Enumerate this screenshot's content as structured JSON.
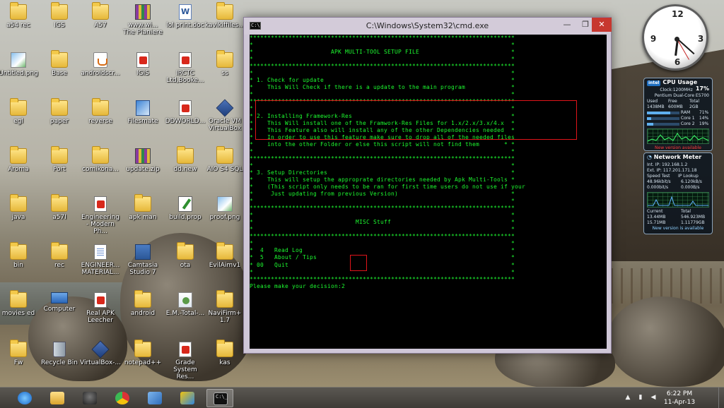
{
  "desktop": {
    "icons": [
      {
        "label": "a54 rec",
        "type": "folder"
      },
      {
        "label": "IGS",
        "type": "folder"
      },
      {
        "label": "A57",
        "type": "folder"
      },
      {
        "label": "www.wi...\nThe Planiere",
        "type": "zip"
      },
      {
        "label": "lol print.doc",
        "type": "word"
      },
      {
        "label": "kavikiffiles...",
        "type": "folder"
      },
      {
        "label": "Untitled.png",
        "type": "img"
      },
      {
        "label": "Base",
        "type": "folder"
      },
      {
        "label": "androidscr...",
        "type": "java"
      },
      {
        "label": "IGIS",
        "type": "pdf"
      },
      {
        "label": "IRCTC Ltd,Booke...",
        "type": "pdf"
      },
      {
        "label": "ss",
        "type": "folder"
      },
      {
        "label": "egl",
        "type": "folder"
      },
      {
        "label": "paper",
        "type": "folder"
      },
      {
        "label": "reverse",
        "type": "folder"
      },
      {
        "label": "Filesmate",
        "type": "tool"
      },
      {
        "label": "DDWORLD...",
        "type": "pdf"
      },
      {
        "label": "Oracle VM VirtualBox",
        "type": "vbox"
      },
      {
        "label": "Aroma",
        "type": "folder"
      },
      {
        "label": "Port",
        "type": "folder"
      },
      {
        "label": "comikona...",
        "type": "folder"
      },
      {
        "label": "update.zip",
        "type": "zip"
      },
      {
        "label": "dd.new",
        "type": "folder"
      },
      {
        "label": "AIO S4 SQL",
        "type": "folder"
      },
      {
        "label": "java",
        "type": "folder"
      },
      {
        "label": "a57I",
        "type": "folder"
      },
      {
        "label": "Engineering - Modern Ph...",
        "type": "pdf"
      },
      {
        "label": "apk man",
        "type": "folder"
      },
      {
        "label": "build.prop",
        "type": "pencil"
      },
      {
        "label": "proof.png",
        "type": "img"
      },
      {
        "label": "bin",
        "type": "folder"
      },
      {
        "label": "rec",
        "type": "folder"
      },
      {
        "label": "ENGINEER... MATERIAL...",
        "type": "doc"
      },
      {
        "label": "Camtasia Studio 7",
        "type": "film"
      },
      {
        "label": "ota",
        "type": "folder"
      },
      {
        "label": "EvilAimv1",
        "type": "folder"
      },
      {
        "label": "movies ed",
        "type": "folder"
      },
      {
        "label": "Computer",
        "type": "comp"
      },
      {
        "label": "Real APK Leecher",
        "type": "pdf"
      },
      {
        "label": "android",
        "type": "folder"
      },
      {
        "label": "E.M.-Total-...",
        "type": "tux"
      },
      {
        "label": "NaviFirm+ 1.7",
        "type": "folder"
      },
      {
        "label": "Fw",
        "type": "folder"
      },
      {
        "label": "Recycle Bin",
        "type": "bin"
      },
      {
        "label": "VirtualBox-...",
        "type": "vbox"
      },
      {
        "label": "notepad++",
        "type": "folder"
      },
      {
        "label": "Grade System Res...",
        "type": "pdf"
      },
      {
        "label": "kas",
        "type": "folder"
      }
    ]
  },
  "window": {
    "icon_text": "C:\\",
    "title": "C:\\Windows\\System32\\cmd.exe",
    "min_glyph": "—",
    "max_glyph": "❐",
    "close_glyph": "✕"
  },
  "console": {
    "lines": [
      "***************************************************************************",
      "*                                                                         *",
      "*                      APK MULTI-TOOL SETUP FILE                          *",
      "*                                                                         *",
      "***************************************************************************",
      "*                                                                         *",
      "* 1. Check for update                                                     *",
      "*    This Will Check if there is a update to the main program             *",
      "*                                                                         *",
      "***************************************************************************",
      "*                                                                         *",
      "* 2. Installing Framework-Res                                             *",
      "*    This Will install one of the Framwork-Res Files for 1.x/2.x/3.x/4.x  *",
      "*    This Feature also will install any of the other Dependencies needed  *",
      "*    In order to use this feature make sure to drop all of the needed files",
      "*    into the other Folder or else this script will not find them       * *",
      "*                                                                         *",
      "***************************************************************************",
      "*                                                                         *",
      "* 3. Setup Directories                                                    *",
      "*    This will setup the approprate directories needed by Apk Multi-Tools *",
      "*    (This script only needs to be ran for first time users do not use if your",
      "*     Just updating from previous Version)                                *",
      "*                                                                         *",
      "***************************************************************************",
      "*                                                                         *",
      "*                             MISC Stuff                                  *",
      "*                                                                         *",
      "***************************************************************************",
      "*                                                                         *",
      "*  4   Read Log                                                           *",
      "*  5   About / Tips                                                       *",
      "* 00   Quit                                                               *",
      "*                                                                         *",
      "***************************************************************************",
      "Please make your decision:2"
    ]
  },
  "gadgets": {
    "cpu": {
      "brand": "intel",
      "title": "CPU Usage",
      "usage": "17%",
      "clock": "Clock:1200MHz",
      "model": "Pentium Dual-Core E5700",
      "mem_headers": [
        "Used",
        "Free",
        "Total"
      ],
      "mem_values": [
        "1438MB",
        "600MB",
        "2GB"
      ],
      "ram_label": "RAM",
      "ram_pct": "71%",
      "ram_fill": 0.71,
      "core1_label": "Core 1",
      "core1_pct": "14%",
      "core1_fill": 0.14,
      "core2_label": "Core 2",
      "core2_pct": "19%",
      "core2_fill": 0.19,
      "notice": "New version available"
    },
    "network": {
      "title": "Network Meter",
      "int_ip": "Int. IP: 192.168.1.2",
      "ext_ip": "Ext. IP: 117.201.171.18",
      "speed_label": "Speed Test",
      "lookup_label": "IP Lookup",
      "up_rate": "48.96kbit/s",
      "up_bytes": "6.120kB/s",
      "down_rate": "0.000bit/s",
      "down_bytes": "0.000B/s",
      "current_label": "Current",
      "total_label": "Total",
      "cur_up": "13.44MB",
      "tot_up": "546.923MB",
      "cur_down": "15.71MB",
      "tot_down": "1.11779GB",
      "notice": "New version is available"
    }
  },
  "clock_gadget": {
    "numerals": [
      "12",
      "3",
      "6",
      "9"
    ]
  },
  "taskbar": {
    "items": [
      {
        "name": "internet-explorer",
        "icon": "ie-icon",
        "active": false
      },
      {
        "name": "file-explorer",
        "icon": "folder-icon",
        "active": false
      },
      {
        "name": "halo-game",
        "icon": "helmet-icon",
        "active": false
      },
      {
        "name": "chrome",
        "icon": "chrome-icon",
        "active": false
      },
      {
        "name": "photo-viewer",
        "icon": "picture-icon",
        "active": false
      },
      {
        "name": "paint-app",
        "icon": "pencil-icon",
        "active": false
      },
      {
        "name": "command-prompt",
        "icon": "cmd-icon",
        "active": true,
        "icon_text": "C:\\_"
      }
    ],
    "tray": {
      "up_glyph": "▲",
      "network_glyph": "▮",
      "volume_glyph": "◀",
      "time": "6:22 PM",
      "date": "11-Apr-13"
    }
  }
}
